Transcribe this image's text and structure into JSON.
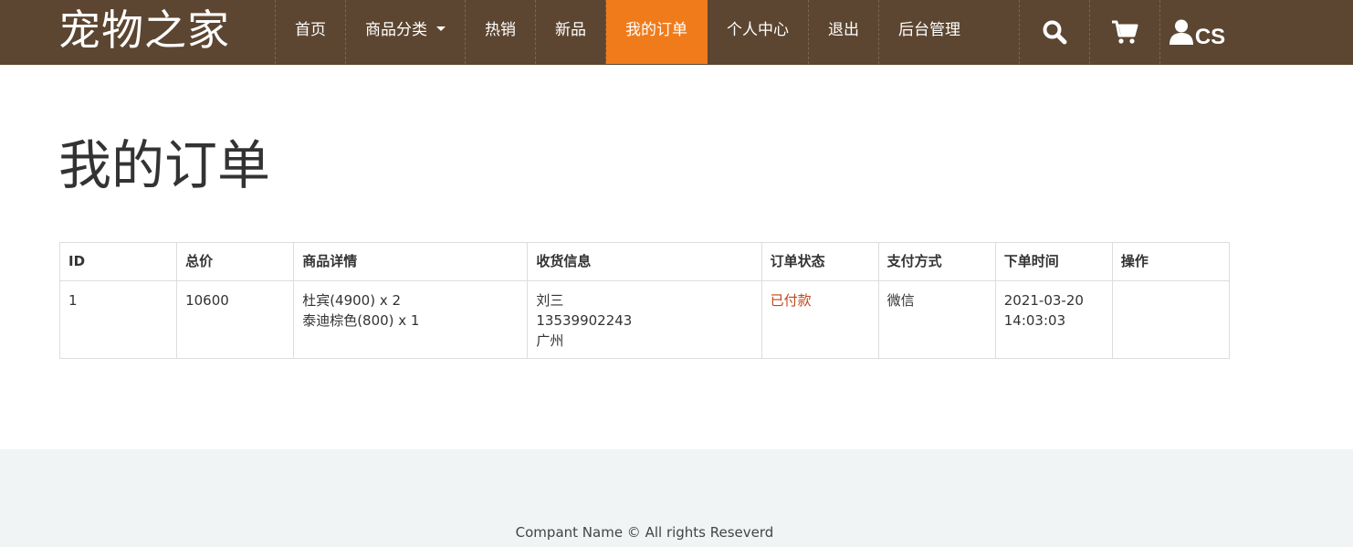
{
  "brand": {
    "name": "宠物之家"
  },
  "nav": {
    "items": [
      {
        "label": "首页",
        "active": false,
        "dropdown": false
      },
      {
        "label": "商品分类",
        "active": false,
        "dropdown": true
      },
      {
        "label": "热销",
        "active": false,
        "dropdown": false
      },
      {
        "label": "新品",
        "active": false,
        "dropdown": false
      },
      {
        "label": "我的订单",
        "active": true,
        "dropdown": false
      },
      {
        "label": "个人中心",
        "active": false,
        "dropdown": false
      },
      {
        "label": "退出",
        "active": false,
        "dropdown": false
      },
      {
        "label": "后台管理",
        "active": false,
        "dropdown": false
      }
    ],
    "icons": {
      "search": "search-icon",
      "cart": "cart-icon",
      "user": "user-icon"
    },
    "username": "CS"
  },
  "page": {
    "title": "我的订单"
  },
  "orders": {
    "headers": [
      "ID",
      "总价",
      "商品详情",
      "收货信息",
      "订单状态",
      "支付方式",
      "下单时间",
      "操作"
    ],
    "rows": [
      {
        "id": "1",
        "total": "10600",
        "items": [
          "杜宾(4900) x 2",
          "泰迪棕色(800) x 1"
        ],
        "shipping": [
          "刘三",
          "13539902243",
          "广州"
        ],
        "status": "已付款",
        "payment": "微信",
        "time": [
          "2021-03-20",
          "14:03:03"
        ],
        "action": ""
      }
    ]
  },
  "footer": {
    "text": "Compant Name © All rights Reseverd"
  },
  "colors": {
    "navbar": "#5c4631",
    "active": "#f07b1b",
    "status_paid": "#c0461b",
    "footer_bg": "#f1f4f4"
  }
}
